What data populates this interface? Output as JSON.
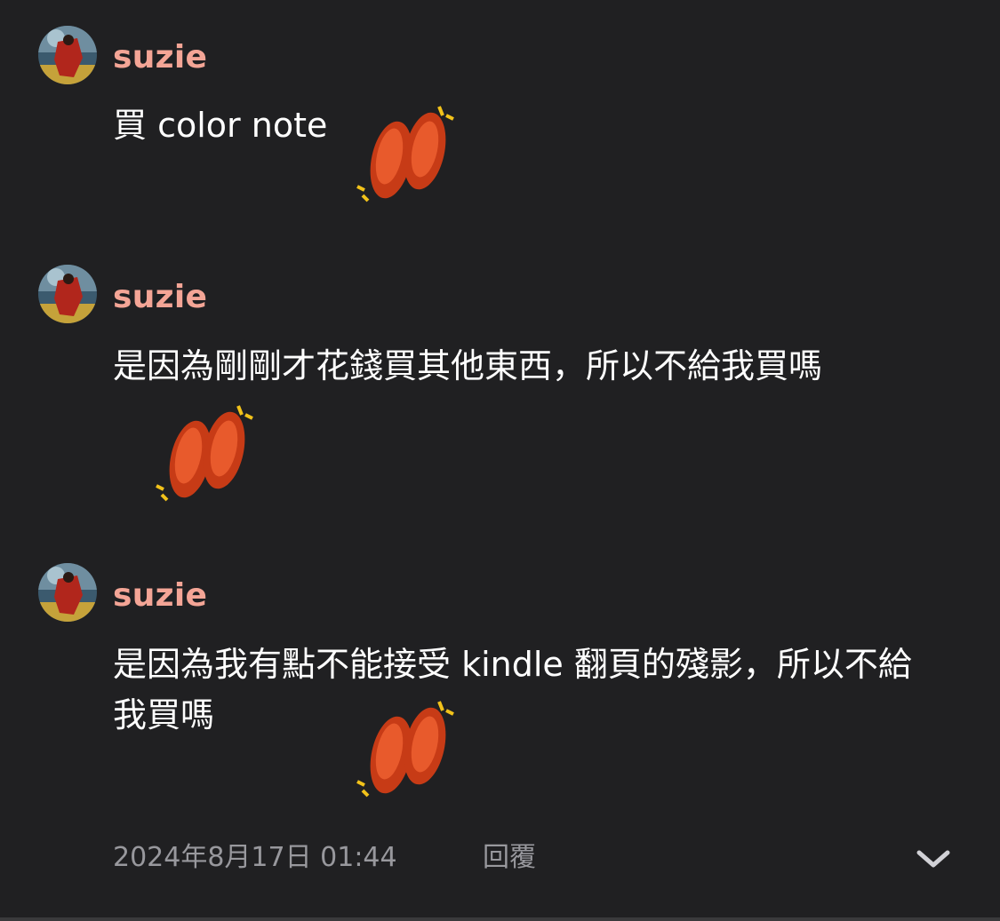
{
  "colors": {
    "background": "#202022",
    "username": "#f4a596",
    "message_text": "#ffffff",
    "meta_text": "#98989d",
    "sticker_red": "#e0481f"
  },
  "messages": [
    {
      "username": "suzie",
      "text": "買 color note",
      "sticker_icon": "kidney-bean-sticker"
    },
    {
      "username": "suzie",
      "text": "是因為剛剛才花錢買其他東西，所以不給我買嗎",
      "sticker_icon": "kidney-bean-sticker"
    },
    {
      "username": "suzie",
      "text": "是因為我有點不能接受 kindle 翻頁的殘影，所以不給我買嗎",
      "sticker_icon": "kidney-bean-sticker"
    }
  ],
  "footer": {
    "timestamp": "2024年8月17日 01:44",
    "reply_label": "回覆",
    "expand_icon": "chevron-down-icon"
  }
}
